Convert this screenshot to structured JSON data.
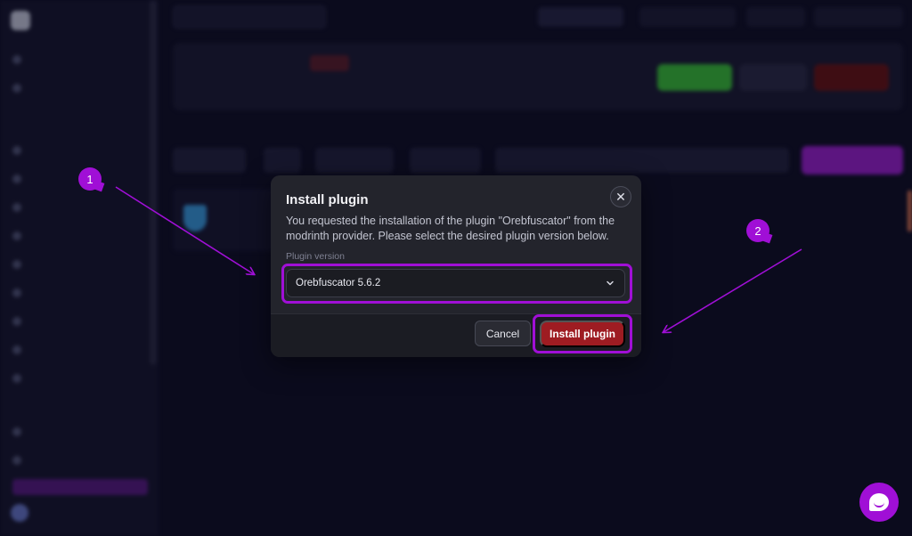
{
  "modal": {
    "title": "Install plugin",
    "description": "You requested the installation of the plugin \"Orebfuscator\" from the modrinth provider. Please select the desired plugin version below.",
    "version_label": "Plugin version",
    "version_value": "Orebfuscator 5.6.2",
    "close_icon": "close-icon",
    "cancel_label": "Cancel",
    "install_label": "Install plugin"
  },
  "annotations": {
    "step1": "1",
    "step2": "2"
  },
  "colors": {
    "accent": "#a00fd6",
    "install_button": "#9e1c22",
    "modal_bg": "#23242c",
    "page_bg": "#0d0d24"
  },
  "icons": {
    "chevron": "chevron-down-icon",
    "chat": "chat-icon"
  }
}
